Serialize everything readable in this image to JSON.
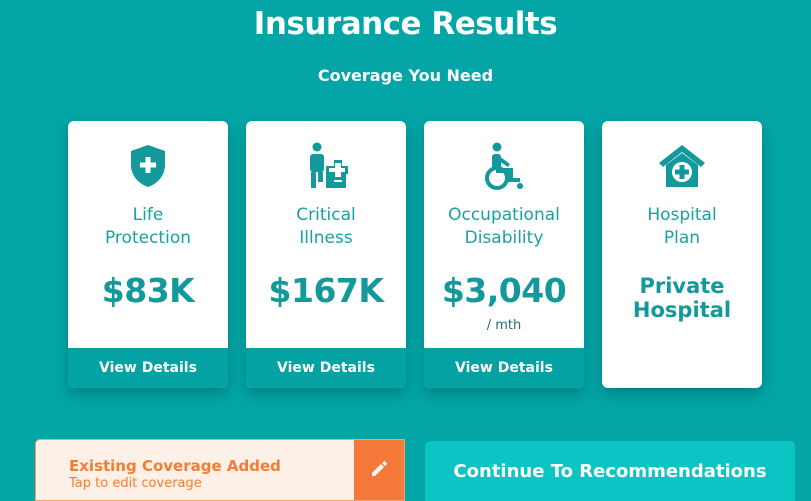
{
  "header": {
    "title": "Insurance Results",
    "subtitle": "Coverage You Need"
  },
  "cards": [
    {
      "icon": "shield-plus-icon",
      "title_line1": "Life",
      "title_line2": "Protection",
      "value": "$83K",
      "unit": "",
      "footer": "View Details"
    },
    {
      "icon": "person-medical-icon",
      "title_line1": "Critical",
      "title_line2": "Illness",
      "value": "$167K",
      "unit": "",
      "footer": "View Details"
    },
    {
      "icon": "wheelchair-icon",
      "title_line1": "Occupational",
      "title_line2": "Disability",
      "value": "$3,040",
      "unit": "/ mth",
      "footer": "View Details"
    },
    {
      "icon": "hospital-house-icon",
      "title_line1": "Hospital",
      "title_line2": "Plan",
      "value_line1": "Private",
      "value_line2": "Hospital"
    }
  ],
  "coverage_banner": {
    "title": "Existing Coverage Added",
    "subtitle": "Tap to edit coverage",
    "edit_icon": "pencil-icon"
  },
  "continue_button": {
    "label": "Continue To Recommendations"
  },
  "colors": {
    "background": "#03a5a6",
    "accent_teal": "#13999b",
    "banner_orange": "#f5793a",
    "button_cyan": "#0dc4c4"
  }
}
